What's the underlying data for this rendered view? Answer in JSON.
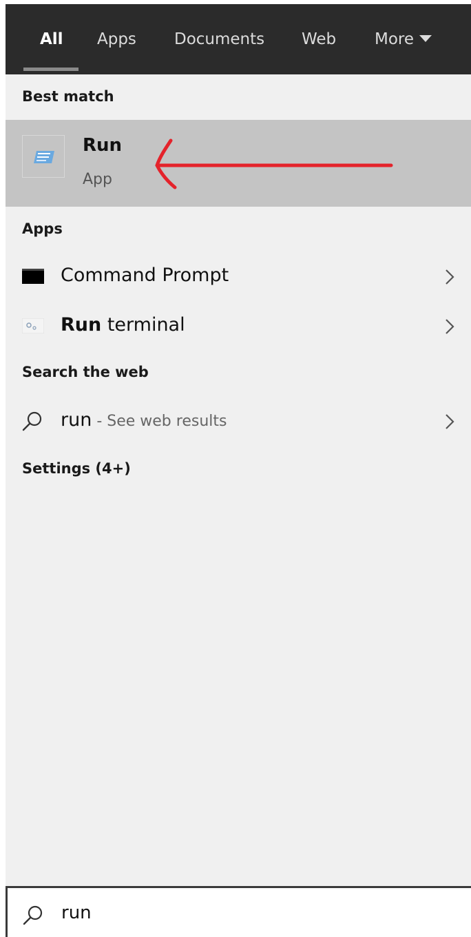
{
  "tabs": [
    {
      "label": "All",
      "active": true
    },
    {
      "label": "Apps",
      "active": false
    },
    {
      "label": "Documents",
      "active": false
    },
    {
      "label": "Web",
      "active": false
    },
    {
      "label": "More",
      "active": false
    }
  ],
  "sections": {
    "best_match": "Best match",
    "apps": "Apps",
    "search_web": "Search the web",
    "settings": "Settings (4+)"
  },
  "best_match": {
    "title": "Run",
    "subtitle": "App",
    "icon": "run-app-icon"
  },
  "apps": [
    {
      "label": "Command Prompt",
      "icon": "command-prompt-icon"
    },
    {
      "label_bold": "Run",
      "label_rest": " terminal",
      "icon": "run-terminal-icon"
    }
  ],
  "web": {
    "query": "run",
    "suffix": " - See web results",
    "icon": "search-icon"
  },
  "search": {
    "value": "run",
    "icon": "search-icon"
  },
  "colors": {
    "tab_bar": "#2b2b2b",
    "panel": "#f0f0f0",
    "highlight": "#c4c4c4",
    "annotation": "#e4232b"
  }
}
